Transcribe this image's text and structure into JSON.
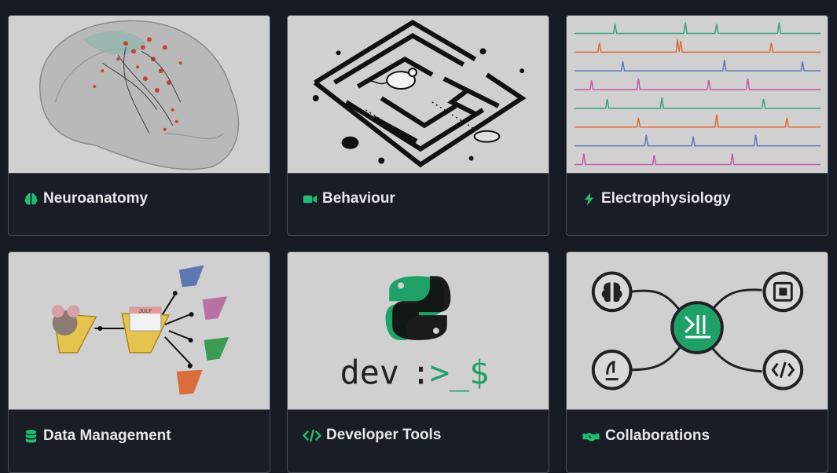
{
  "accent_color": "#1fbf72",
  "cards": [
    {
      "title": "Neuroanatomy",
      "icon": "brain-icon"
    },
    {
      "title": "Behaviour",
      "icon": "video-camera-icon"
    },
    {
      "title": "Electrophysiology",
      "icon": "lightning-bolt-icon"
    },
    {
      "title": "Data Management",
      "icon": "database-icon"
    },
    {
      "title": "Developer Tools",
      "icon": "code-icon"
    },
    {
      "title": "Collaborations",
      "icon": "handshake-icon"
    }
  ],
  "calendar_label": "JULY",
  "devtools_text": {
    "prefix": "dev",
    "colon": ":",
    "prompt": ">_$"
  }
}
